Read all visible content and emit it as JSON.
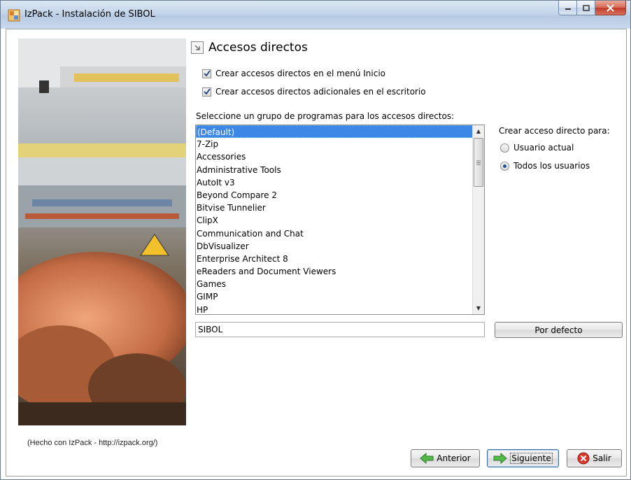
{
  "window": {
    "title": "IzPack - Instalación de  SIBOL",
    "minimize_label": "–",
    "maximize_label": "□",
    "close_label": "✕"
  },
  "panel": {
    "title": "Accesos directos",
    "checkbox_start_menu": "Crear accesos directos en el menú Inicio",
    "checkbox_desktop": "Crear accesos directos adicionales en el escritorio",
    "group_label": "Seleccione un grupo de programas para los accesos directos:",
    "program_groups": [
      "(Default)",
      "7-Zip",
      "Accessories",
      "Administrative Tools",
      "AutoIt v3",
      "Beyond Compare 2",
      "Bitvise Tunnelier",
      "ClipX",
      "Communication and Chat",
      "DbVisualizer",
      "Enterprise Architect 8",
      "eReaders and Document Viewers",
      "Games",
      "GIMP",
      "HP"
    ],
    "selected_group": "(Default)",
    "shortcut_for_label": "Crear acceso directo para:",
    "radio_current_user": "Usuario actual",
    "radio_all_users": "Todos los usuarios",
    "selected_radio": "Todos los usuarios",
    "group_name_value": "SIBOL",
    "default_button": "Por defecto"
  },
  "footer": {
    "made_with": "(Hecho con IzPack - http://izpack.org/)",
    "back_button": "Anterior",
    "next_button": "Siguiente",
    "exit_button": "Salir"
  },
  "colors": {
    "selection": "#3c86e6",
    "titlebar": "#c4d5ea",
    "close_button": "#c0392b"
  }
}
